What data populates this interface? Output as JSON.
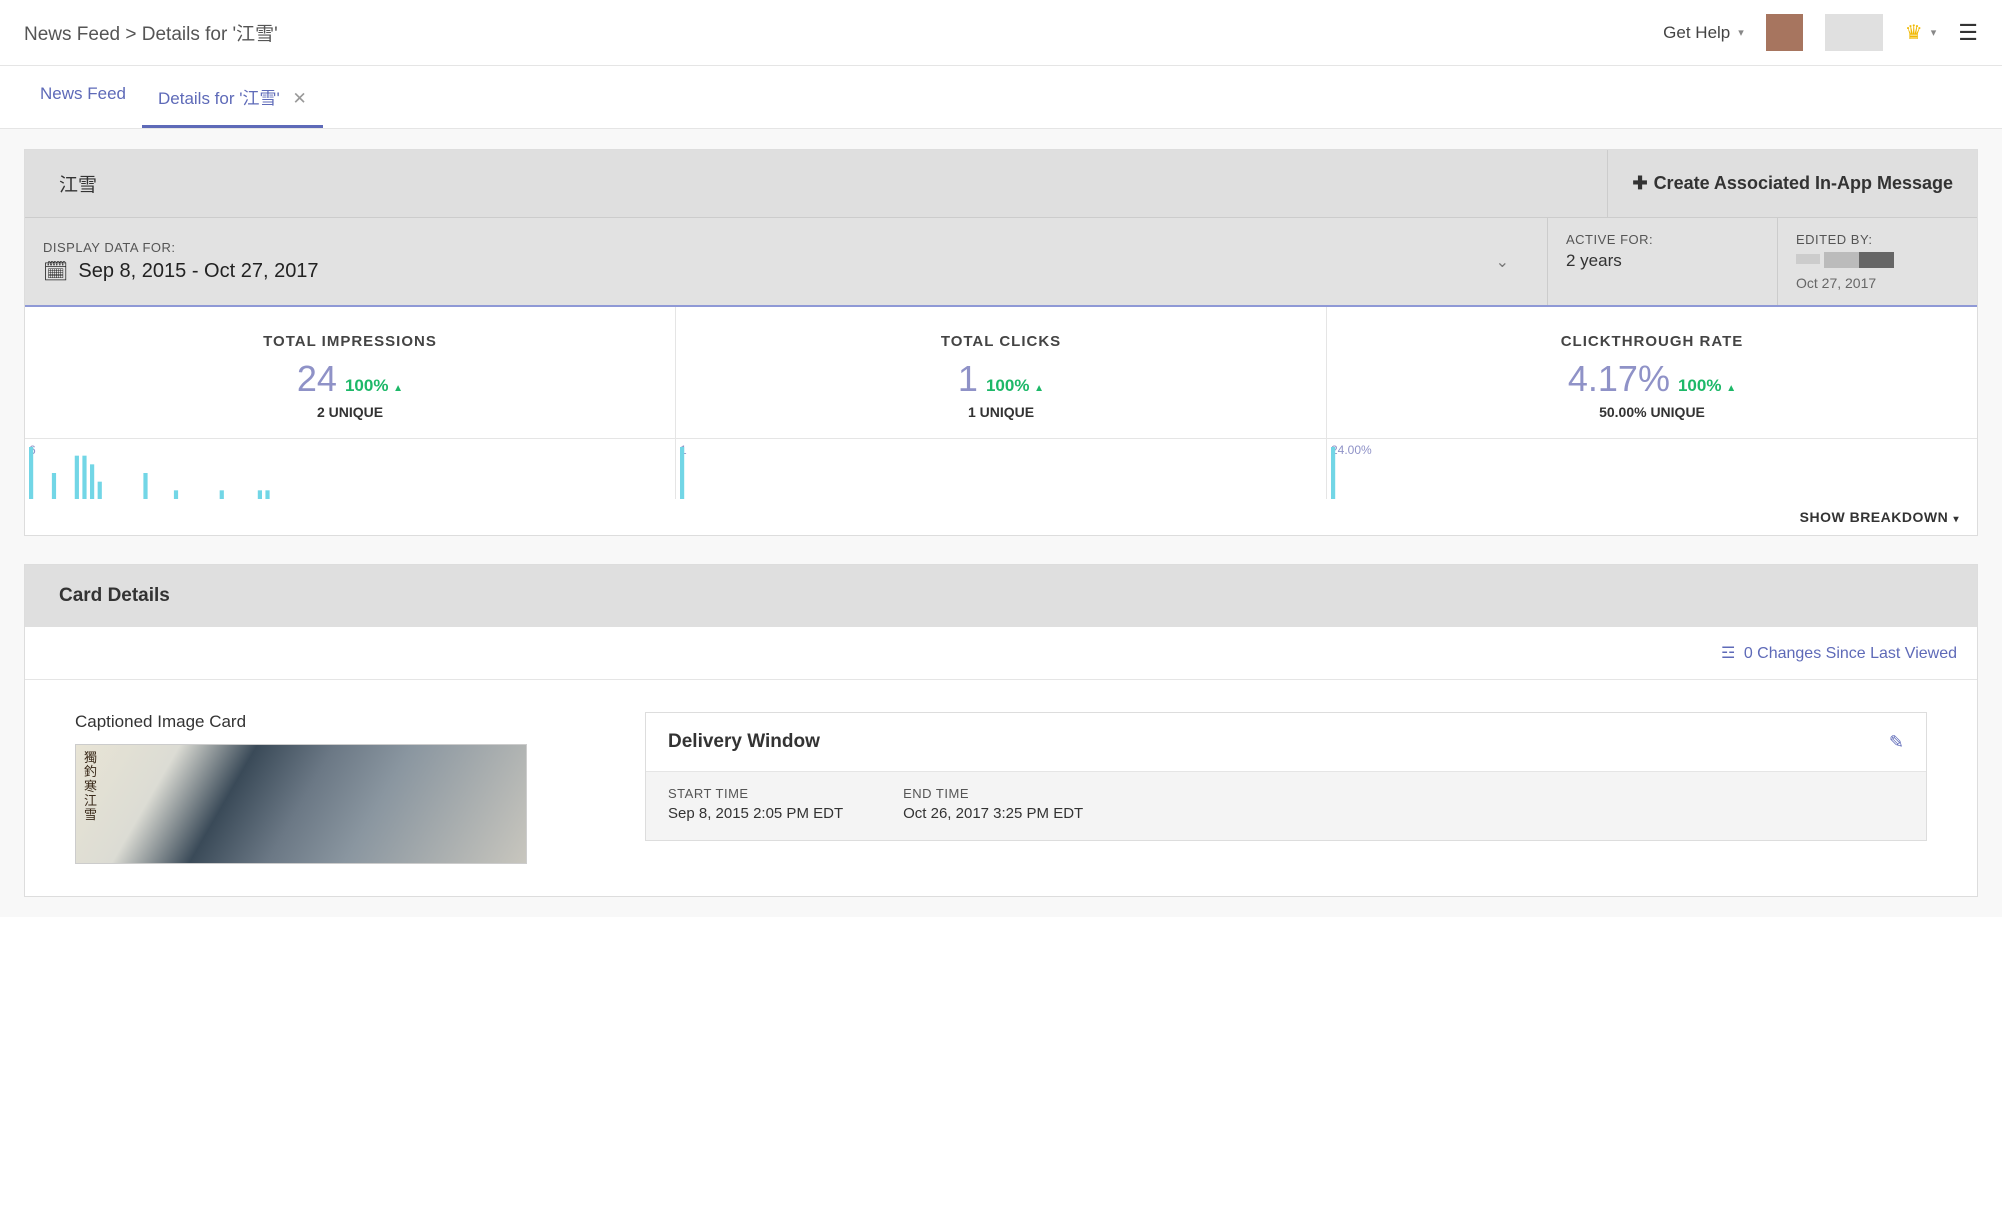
{
  "header": {
    "breadcrumb": "News Feed > Details for '江雪'",
    "getHelp": "Get Help"
  },
  "tabs": [
    {
      "label": "News Feed",
      "active": false,
      "closable": false
    },
    {
      "label": "Details for '江雪'",
      "active": true,
      "closable": true
    }
  ],
  "panel": {
    "title": "江雪",
    "createBtn": "Create Associated In-App Message"
  },
  "filter": {
    "label": "DISPLAY DATA FOR:",
    "range": "Sep 8, 2015 - Oct 27, 2017",
    "activeLabel": "ACTIVE FOR:",
    "activeVal": "2 years",
    "editedLabel": "EDITED BY:",
    "editedDate": "Oct 27, 2017"
  },
  "metrics": {
    "impressions": {
      "label": "TOTAL IMPRESSIONS",
      "value": "24",
      "pct": "100%",
      "sub": "2 UNIQUE",
      "max": "6"
    },
    "clicks": {
      "label": "TOTAL CLICKS",
      "value": "1",
      "pct": "100%",
      "sub": "1 UNIQUE",
      "max": "1"
    },
    "ctr": {
      "label": "CLICKTHROUGH RATE",
      "value": "4.17%",
      "pct": "100%",
      "sub": "50.00% UNIQUE",
      "max": "24.00%"
    }
  },
  "breakdown": "SHOW BREAKDOWN",
  "cardDetails": {
    "header": "Card Details",
    "changes": "0 Changes Since Last Viewed",
    "cardType": "Captioned Image Card"
  },
  "delivery": {
    "title": "Delivery Window",
    "startLabel": "START TIME",
    "startVal": "Sep 8, 2015 2:05 PM EDT",
    "endLabel": "END TIME",
    "endVal": "Oct 26, 2017 3:25 PM EDT"
  },
  "chart_data": [
    {
      "type": "bar",
      "title": "Total Impressions sparkline",
      "ylim": [
        0,
        6
      ],
      "values": [
        6,
        0,
        0,
        3,
        0,
        0,
        5,
        5,
        4,
        2,
        0,
        0,
        0,
        0,
        0,
        3,
        0,
        0,
        0,
        1,
        0,
        0,
        0,
        0,
        0,
        1,
        0,
        0,
        0,
        0,
        1,
        1,
        0,
        0,
        0,
        0,
        0,
        0,
        0,
        0,
        0,
        0,
        0,
        0,
        0,
        0,
        0,
        0,
        0,
        0,
        0,
        0,
        0,
        0,
        0,
        0,
        0,
        0,
        0,
        0
      ]
    },
    {
      "type": "bar",
      "title": "Total Clicks sparkline",
      "ylim": [
        0,
        1
      ],
      "values": [
        1,
        0,
        0,
        0,
        0,
        0,
        0,
        0,
        0,
        0,
        0,
        0,
        0,
        0,
        0,
        0,
        0,
        0,
        0,
        0,
        0,
        0,
        0,
        0,
        0,
        0,
        0,
        0,
        0,
        0,
        0,
        0,
        0,
        0,
        0,
        0,
        0,
        0,
        0,
        0,
        0,
        0,
        0,
        0,
        0,
        0,
        0,
        0,
        0,
        0,
        0,
        0,
        0,
        0,
        0,
        0,
        0,
        0,
        0,
        0
      ]
    },
    {
      "type": "bar",
      "title": "Clickthrough Rate sparkline",
      "ylim": [
        0,
        24
      ],
      "values": [
        24,
        0,
        0,
        0,
        0,
        0,
        0,
        0,
        0,
        0,
        0,
        0,
        0,
        0,
        0,
        0,
        0,
        0,
        0,
        0,
        0,
        0,
        0,
        0,
        0,
        0,
        0,
        0,
        0,
        0,
        0,
        0,
        0,
        0,
        0,
        0,
        0,
        0,
        0,
        0,
        0,
        0,
        0,
        0,
        0,
        0,
        0,
        0,
        0,
        0,
        0,
        0,
        0,
        0,
        0,
        0,
        0,
        0,
        0,
        0
      ]
    }
  ]
}
